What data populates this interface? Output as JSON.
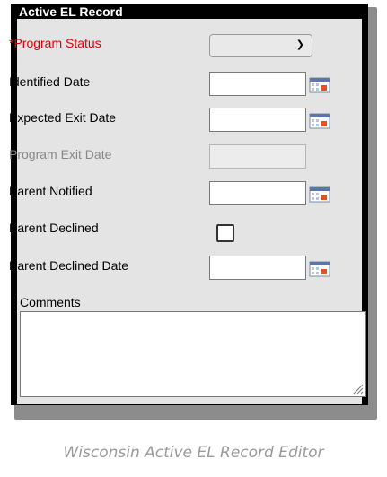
{
  "panel": {
    "title": "Active EL Record"
  },
  "fields": {
    "program_status_label": "*Program Status",
    "program_status_value": "",
    "identified_date_label": "Identified Date",
    "identified_date_value": "",
    "expected_exit_label": "Expected Exit Date",
    "expected_exit_value": "",
    "program_exit_label": "Program Exit Date",
    "program_exit_value": "",
    "parent_notified_label": "Parent Notified",
    "parent_notified_value": "",
    "parent_declined_label": "Parent Declined",
    "parent_declined_checked": false,
    "parent_declined_date_label": "Parent Declined Date",
    "parent_declined_date_value": "",
    "comments_label": "Comments",
    "comments_value": ""
  },
  "icons": {
    "dropdown": "chevron-down-icon",
    "date_picker": "calendar-icon",
    "resize": "resize-grip-icon"
  },
  "colors": {
    "required_label": "#e00000",
    "disabled_label": "#888888",
    "panel_header": "#000000",
    "panel_body": "#e4e4e4"
  },
  "caption": "Wisconsin Active EL Record Editor"
}
